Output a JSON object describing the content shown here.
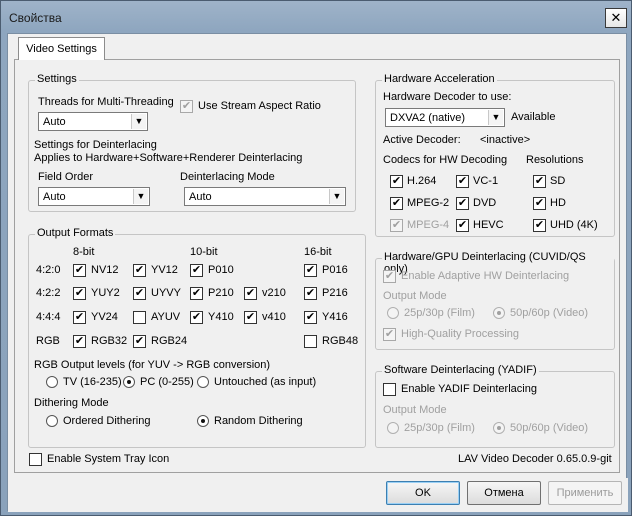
{
  "window": {
    "title": "Свойства",
    "close_glyph": "✕"
  },
  "tab": {
    "label": "Video Settings"
  },
  "settings": {
    "title": "Settings",
    "threads_label": "Threads for Multi-Threading",
    "threads_value": "Auto",
    "stream_aspect_label": "Use Stream Aspect Ratio",
    "deint_title": "Settings for Deinterlacing",
    "deint_applies": "Applies to Hardware+Software+Renderer Deinterlacing",
    "field_order_label": "Field Order",
    "field_order_value": "Auto",
    "deint_mode_label": "Deinterlacing Mode",
    "deint_mode_value": "Auto"
  },
  "output": {
    "title": "Output Formats",
    "col_8": "8-bit",
    "col_10": "10-bit",
    "col_16": "16-bit",
    "rows": {
      "r420": "4:2:0",
      "r422": "4:2:2",
      "r444": "4:4:4",
      "rgb": "RGB"
    },
    "formats": {
      "nv12": "NV12",
      "yv12": "YV12",
      "p010": "P010",
      "p016": "P016",
      "yuy2": "YUY2",
      "uyvy": "UYVY",
      "p210": "P210",
      "v210": "v210",
      "p216": "P216",
      "yv24": "YV24",
      "ayuv": "AYUV",
      "y410": "Y410",
      "v410": "v410",
      "y416": "Y416",
      "rgb32": "RGB32",
      "rgb24": "RGB24",
      "rgb48": "RGB48"
    },
    "levels_label": "RGB Output levels (for YUV -> RGB conversion)",
    "levels_tv": "TV (16-235)",
    "levels_pc": "PC (0-255)",
    "levels_untouched": "Untouched (as input)",
    "dither_label": "Dithering Mode",
    "dither_ordered": "Ordered Dithering",
    "dither_random": "Random Dithering"
  },
  "hwaccel": {
    "title": "Hardware Acceleration",
    "decoder_label": "Hardware Decoder to use:",
    "decoder_value": "DXVA2 (native)",
    "available": "Available",
    "active_label": "Active Decoder:",
    "active_value": "<inactive>",
    "codecs_label": "Codecs for HW Decoding",
    "resolutions_label": "Resolutions",
    "h264": "H.264",
    "vc1": "VC-1",
    "sd": "SD",
    "mpeg2": "MPEG-2",
    "dvd": "DVD",
    "hd": "HD",
    "mpeg4": "MPEG-4",
    "hevc": "HEVC",
    "uhd": "UHD (4K)"
  },
  "hwdeint": {
    "title": "Hardware/GPU Deinterlacing (CUVID/QS only)",
    "enable_adaptive": "Enable Adaptive HW Deinterlacing",
    "output_mode": "Output Mode",
    "film": "25p/30p (Film)",
    "video": "50p/60p (Video)",
    "hq": "High-Quality Processing"
  },
  "swdeint": {
    "title": "Software Deinterlacing (YADIF)",
    "enable_yadif": "Enable YADIF Deinterlacing",
    "output_mode": "Output Mode",
    "film": "25p/30p (Film)",
    "video": "50p/60p (Video)"
  },
  "footer": {
    "tray_icon": "Enable System Tray Icon",
    "version": "LAV Video Decoder 0.65.0.9-git",
    "ok": "OK",
    "cancel": "Отмена",
    "apply": "Применить"
  },
  "check_glyph": "✔",
  "arrow_glyph": "▼"
}
